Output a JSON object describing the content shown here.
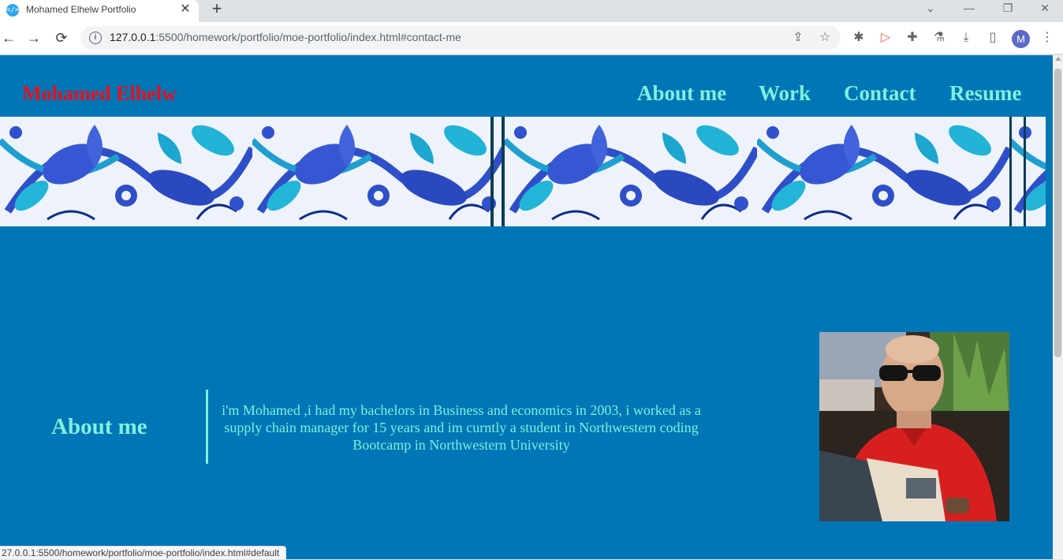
{
  "browser": {
    "tab_title": "Mohamed Elhelw Portfolio",
    "favicon_glyph": "</>",
    "tab_close": "✕",
    "new_tab": "+",
    "url_host": "127.0.0.1",
    "url_rest": ":5500/homework/portfolio/moe-portfolio/index.html#contact-me",
    "profile_initial": "M",
    "status_url": "27.0.0.1:5500/homework/portfolio/moe-portfolio/index.html#default",
    "icons": {
      "back": "←",
      "forward": "→",
      "reload": "⟳",
      "info": "i",
      "share": "⇪",
      "star": "☆",
      "bug": "✱",
      "cast": "▷",
      "puzzle": "✚",
      "flask": "⚗",
      "download": "⤓",
      "sidepanel": "▯",
      "menu": "⋮",
      "tab_search": "⌄",
      "minimize": "—",
      "restore": "❐",
      "close": "✕"
    }
  },
  "site": {
    "name": "Mohamed Elhelw",
    "nav": [
      "About me",
      "Work",
      "Contact",
      "Resume"
    ],
    "about_heading": "About me",
    "about_text": "i'm Mohamed ,i had my bachelors in Business and economics in 2003, i worked as a supply chain manager for 15 years and im curntly a student in Northwestern coding Bootcamp in Northwestern University"
  },
  "colors": {
    "page_bg": "#0076b6",
    "name_color": "#e8101e",
    "accent": "#7ff0dc"
  }
}
